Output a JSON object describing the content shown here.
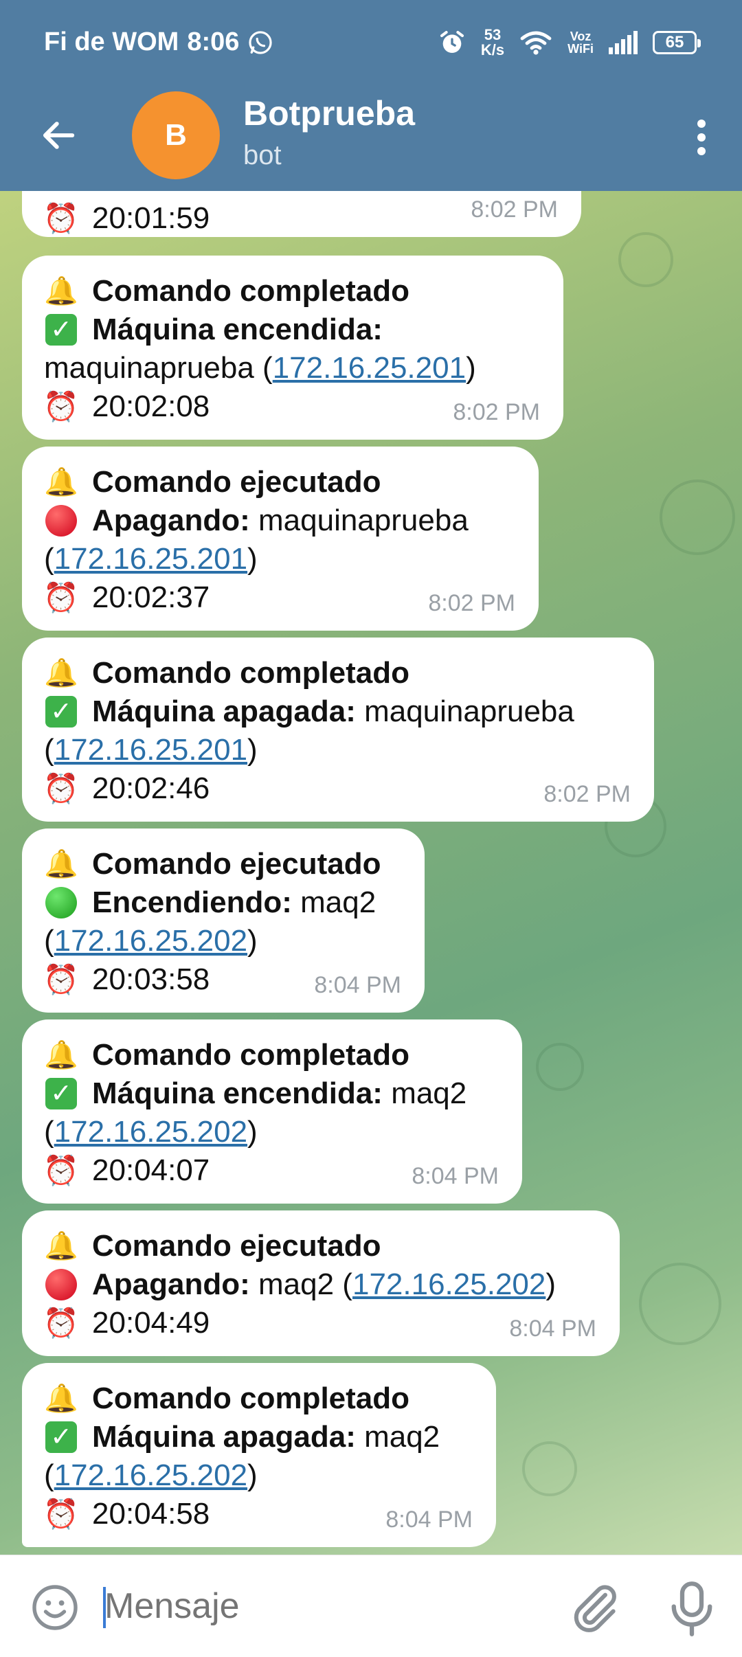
{
  "status_bar": {
    "carrier": "Fi de WOM",
    "time": "8:06",
    "speed_value": "53",
    "speed_unit": "K/s",
    "voz_top": "Voz",
    "voz_bottom": "WiFi",
    "battery": "65"
  },
  "header": {
    "avatar_letter": "B",
    "title": "Botprueba",
    "subtitle": "bot"
  },
  "messages": [
    {
      "time_line": "20:01:59",
      "timestamp": "8:02 PM"
    },
    {
      "heading": "Comando completado",
      "status_label": "Máquina encendida:",
      "host": "maquinaprueba",
      "ip": "172.16.25.201",
      "time_line": "20:02:08",
      "timestamp": "8:02 PM"
    },
    {
      "heading": "Comando ejecutado",
      "status_label": "Apagando:",
      "host": "maquinaprueba",
      "ip": "172.16.25.201",
      "time_line": "20:02:37",
      "timestamp": "8:02 PM"
    },
    {
      "heading": "Comando completado",
      "status_label": "Máquina apagada:",
      "host": "maquinaprueba",
      "ip": "172.16.25.201",
      "time_line": "20:02:46",
      "timestamp": "8:02 PM"
    },
    {
      "heading": "Comando ejecutado",
      "status_label": "Encendiendo:",
      "host": "maq2",
      "ip": "172.16.25.202",
      "time_line": "20:03:58",
      "timestamp": "8:04 PM"
    },
    {
      "heading": "Comando completado",
      "status_label": "Máquina encendida:",
      "host": "maq2",
      "ip": "172.16.25.202",
      "time_line": "20:04:07",
      "timestamp": "8:04 PM"
    },
    {
      "heading": "Comando ejecutado",
      "status_label": "Apagando:",
      "host": "maq2",
      "ip": "172.16.25.202",
      "time_line": "20:04:49",
      "timestamp": "8:04 PM"
    },
    {
      "heading": "Comando completado",
      "status_label": "Máquina apagada:",
      "host": "maq2",
      "ip": "172.16.25.202",
      "time_line": "20:04:58",
      "timestamp": "8:04 PM"
    }
  ],
  "input": {
    "placeholder": "Mensaje"
  },
  "colors": {
    "header_bg": "#517da2",
    "avatar_bg": "#f5922f",
    "link": "#2a6fa8"
  },
  "icons": [
    "whatsapp-icon",
    "alarm-icon",
    "wifi-icon",
    "signal-icon",
    "battery-icon",
    "back-arrow-icon",
    "more-vert-icon",
    "bell-icon",
    "check-mark-icon",
    "red-circle-icon",
    "green-circle-icon",
    "alarm-clock-icon",
    "emoji-icon",
    "attach-icon",
    "mic-icon"
  ]
}
